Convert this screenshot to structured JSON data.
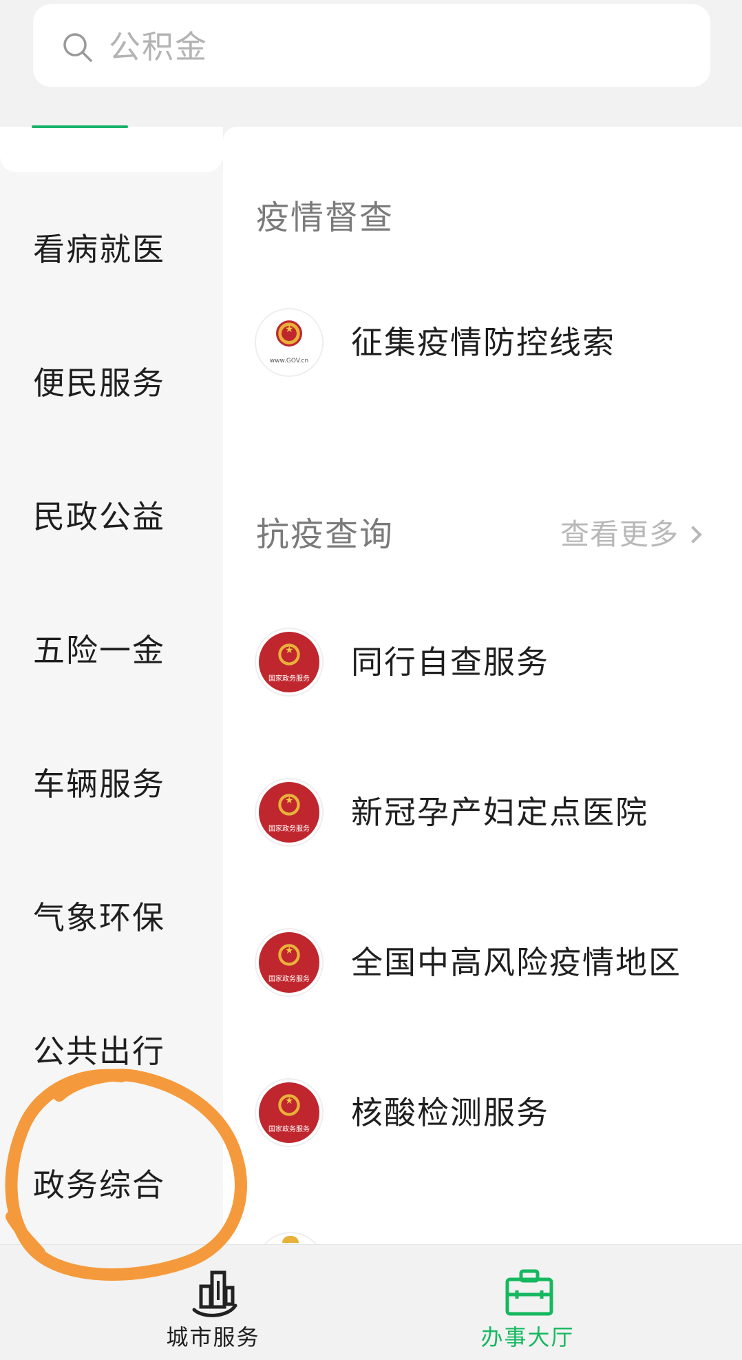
{
  "search": {
    "placeholder": "公积金",
    "icon": "search-icon"
  },
  "sidebar": {
    "items": [
      {
        "label": "看病就医"
      },
      {
        "label": "便民服务"
      },
      {
        "label": "民政公益"
      },
      {
        "label": "五险一金"
      },
      {
        "label": "车辆服务"
      },
      {
        "label": "气象环保"
      },
      {
        "label": "公共出行"
      },
      {
        "label": "政务综合"
      }
    ]
  },
  "main": {
    "sections": [
      {
        "title": "疫情督查",
        "items": [
          {
            "label": "征集疫情防控线索",
            "icon": "gov-emblem-icon",
            "icon_text": "www.GOV.cn"
          }
        ]
      },
      {
        "title": "抗疫查询",
        "more_label": "查看更多",
        "items": [
          {
            "label": "同行自查服务",
            "icon": "national-gov-service-icon",
            "icon_text": "国家政务服务"
          },
          {
            "label": "新冠孕产妇定点医院",
            "icon": "national-gov-service-icon",
            "icon_text": "国家政务服务"
          },
          {
            "label": "全国中高风险疫情地区",
            "icon": "national-gov-service-icon",
            "icon_text": "国家政务服务"
          },
          {
            "label": "核酸检测服务",
            "icon": "national-gov-service-icon",
            "icon_text": "国家政务服务"
          }
        ]
      }
    ]
  },
  "bottom_nav": {
    "tabs": [
      {
        "label": "城市服务",
        "icon": "city-buildings-icon",
        "active": false
      },
      {
        "label": "办事大厅",
        "icon": "briefcase-icon",
        "active": true
      }
    ]
  },
  "colors": {
    "accent": "#16b85f",
    "annotation": "#f59a3c",
    "emblem_red": "#c0262d"
  }
}
